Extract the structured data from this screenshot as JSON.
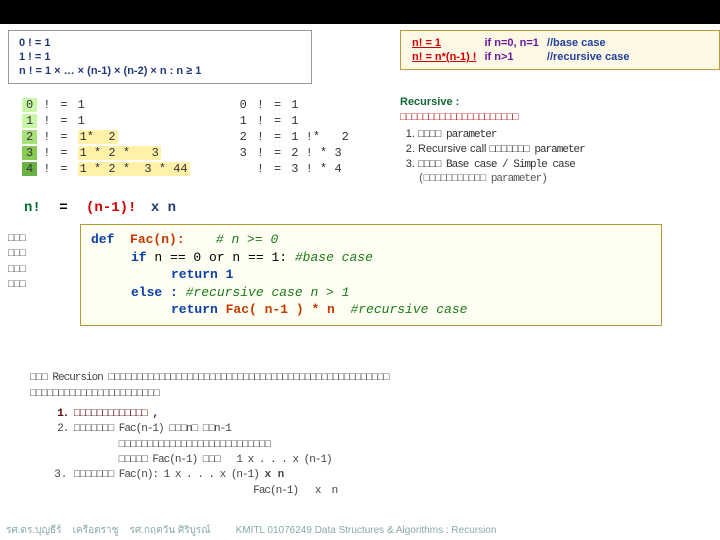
{
  "top": {
    "r0": "0 ! = 1",
    "r1": "1 ! = 1",
    "r2": "n ! = 1  ×  …  ×  (n-1)  ×  (n-2)  ×  n  :  n ≥ 1"
  },
  "rule": {
    "l1a": "n! = 1",
    "l1b": "if n=0, n=1",
    "l1c": "//base case",
    "l2a": "n! = n*(n-1) !",
    "l2b": "if n>1",
    "l2c": "//recursive case"
  },
  "expand": {
    "r": [
      [
        "0",
        "!",
        "=",
        "1",
        "",
        "0",
        "!",
        "=",
        "1"
      ],
      [
        "1",
        "!",
        "=",
        "1",
        "",
        "1",
        "!",
        "=",
        "1"
      ],
      [
        "2",
        "!",
        "=",
        "1*  2",
        "",
        "2",
        "!",
        "=",
        "1 !*   2"
      ],
      [
        "3",
        "!",
        "=",
        "1 * 2 *   3",
        "",
        "3",
        "!",
        "=",
        "2 ! * 3"
      ],
      [
        "4",
        "!",
        "=",
        "1 * 2 *  3 * 44",
        "",
        "",
        "!",
        "=",
        "3 ! * 4"
      ]
    ]
  },
  "rec": {
    "title": "Recursive :",
    "sub": "□□□□□□□□□□□□□□□□□□□□□",
    "i1": "□□□□ parameter",
    "i2_a": "Recursive call ",
    "i2_b": "□□□□□□□ parameter",
    "i3": "□□□□ Base case / Simple case",
    "tail": "(□□□□□□□□□□□ parameter)"
  },
  "nfact": {
    "a": "n!",
    "b": "=",
    "c": "(n-1)!",
    "d": "x n"
  },
  "code": {
    "l1_def": "def",
    "l1_fn": "Fac(n):",
    "l1_cmt": "# n >= 0",
    "l2_if": "if",
    "l2_cond": "n == 0 or n == 1:",
    "l2_cmt": "#base case",
    "l3": "return 1",
    "l4_else": "else :",
    "l4_cmt": "#recursive case  n > 1",
    "l5_ret": "return",
    "l5_call": "Fac( n-1 ) * n",
    "l5_cmt": "#recursive case"
  },
  "thai_left": "□□□\n□□□\n□□□\n□□□",
  "lower": {
    "head": "□□□ Recursion □□□□□□□□□□□□□□□□□□□□□□□□□□□□□□□□□□□□□□□□□□□□□□□□□□",
    "head2": "□□□□□□□□□□□□□□□□□□□□□□□",
    "i1": "□□□□□□□□□□□□□  ,",
    "i2": "□□□□□□□ Fac(n-1) □□□n□ □□n-1\n        □□□□□□□□□□□□□□□□□□□□□□□□□□□\n        □□□□□ Fac(n-1) □□□   1 x . . . x (n-1)",
    "i3_a": "□□□□□□□ Fac(n): 1 x . . . x (n-1) ",
    "i3_b": "x n",
    "i3_c": "                                Fac(n-1)   x  n"
  },
  "foot": {
    "a": "รศ.ดร.บุญธีร์",
    "b": "เครือตราชู",
    "c": "รศ.กฤตวัน  ศิริบูรณ์",
    "d": "KMITL   01076249 Data Structures & Algorithms : Recursion"
  }
}
